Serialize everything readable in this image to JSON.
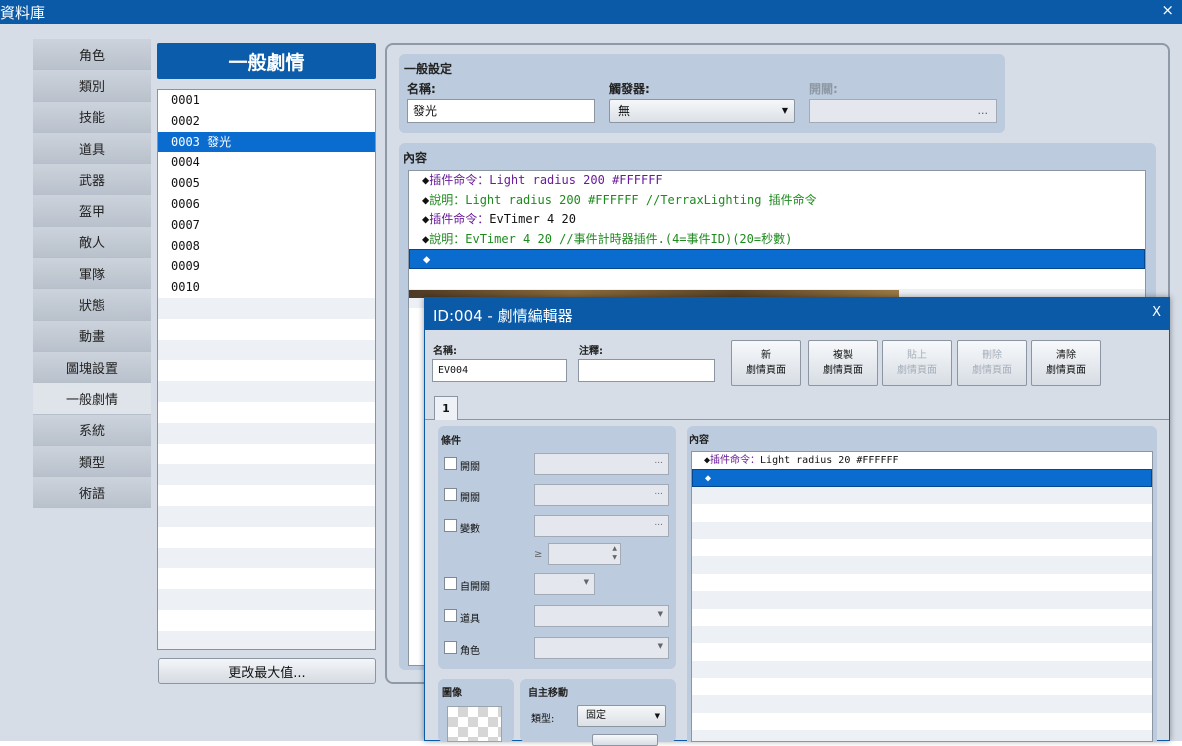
{
  "window": {
    "title": "資料庫",
    "close_glyph": "×"
  },
  "categories": [
    "角色",
    "類別",
    "技能",
    "道具",
    "武器",
    "盔甲",
    "敵人",
    "軍隊",
    "狀態",
    "動畫",
    "圖塊設置",
    "一般劇情",
    "系統",
    "類型",
    "術語"
  ],
  "list": {
    "header": "一般劇情",
    "rows": [
      "0001",
      "0002",
      "0003 發光",
      "0004",
      "0005",
      "0006",
      "0007",
      "0008",
      "0009",
      "0010"
    ],
    "max_button": "更改最大值..."
  },
  "general": {
    "title": "一般設定",
    "name_label": "名稱:",
    "name_value": "發光",
    "trigger_label": "觸發器:",
    "trigger_value": "無",
    "switch_label": "開關:",
    "ellipsis": "..."
  },
  "content": {
    "title": "內容",
    "commands": [
      {
        "prefix": "◆",
        "head": "插件命令：",
        "text": "Light radius 200 #FFFFFF",
        "style": "purple"
      },
      {
        "prefix": "◆",
        "head": "說明：",
        "text": "Light radius 200 #FFFFFF  //TerraxLighting 插件命令",
        "style": "green"
      },
      {
        "prefix": "◆",
        "head": "插件命令：",
        "text": "EvTimer 4 20",
        "style": "purple"
      },
      {
        "prefix": "◆",
        "head": "說明：",
        "text": "EvTimer 4 20  //事件計時器插件.(4=事件ID)(20=秒數)",
        "style": "green"
      }
    ],
    "empty_marker": "◆"
  },
  "dialog": {
    "title": "ID:004 - 劇情編輯器",
    "close_glyph": "X",
    "name_label": "名稱:",
    "name_value": "EV004",
    "note_label": "注釋:",
    "note_value": "",
    "buttons": [
      {
        "l1": "新",
        "l2": "劇情頁面",
        "enabled": true
      },
      {
        "l1": "複製",
        "l2": "劇情頁面",
        "enabled": true
      },
      {
        "l1": "貼上",
        "l2": "劇情頁面",
        "enabled": false
      },
      {
        "l1": "刪除",
        "l2": "劇情頁面",
        "enabled": false
      },
      {
        "l1": "清除",
        "l2": "劇情頁面",
        "enabled": true
      }
    ],
    "tab": "1",
    "conditions": {
      "title": "條件",
      "switch1": "開關",
      "switch2": "開關",
      "variable": "變數",
      "gte": "≥",
      "self_switch": "自開關",
      "item": "道具",
      "actor": "角色"
    },
    "content_title": "內容",
    "commands": [
      {
        "prefix": "◆",
        "head": "插件命令：",
        "text": "Light radius 20 #FFFFFF"
      }
    ],
    "empty_marker": "◆",
    "image_title": "圖像",
    "auto_title": "自主移動",
    "type_label": "類型:",
    "type_value": "固定"
  }
}
